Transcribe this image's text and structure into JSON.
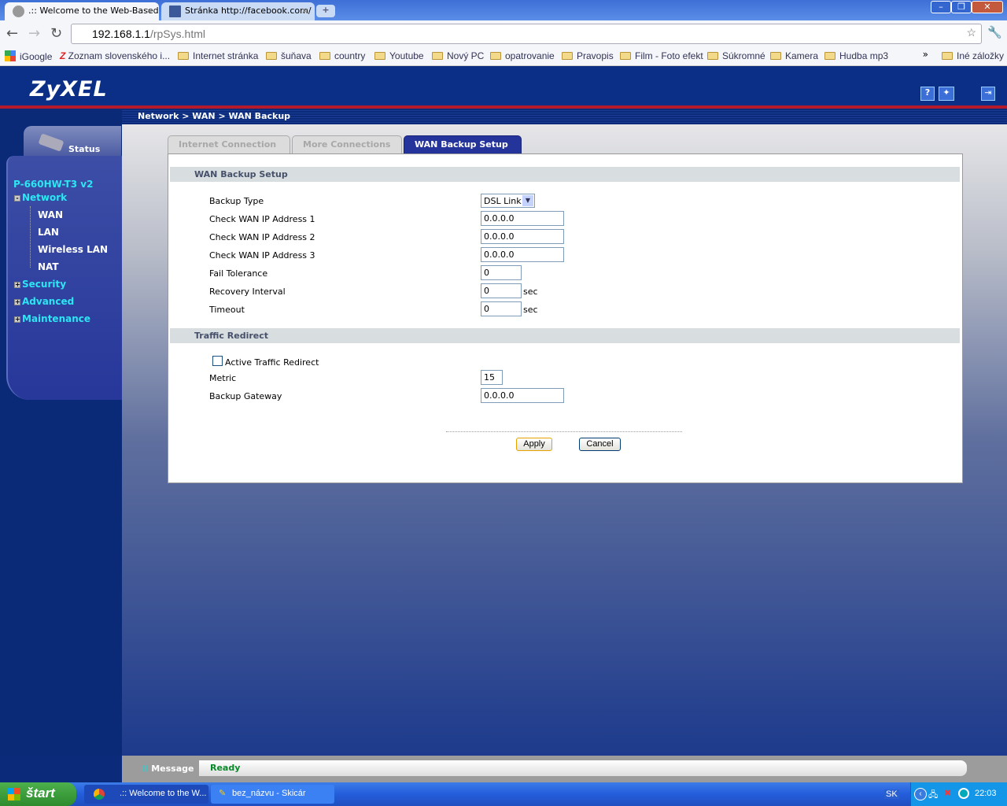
{
  "browser": {
    "tabs": [
      {
        "label": ".:: Welcome to the Web-Based"
      },
      {
        "label": "Stránka http://facebook.com/"
      }
    ],
    "url_host": "192.168.1.1",
    "url_path": "/rpSys.html",
    "bookmarks": [
      "iGoogle",
      "Zoznam slovenského i...",
      "Internet stránka",
      "šuňava",
      "country",
      "Youtube",
      "Nový PC",
      "opatrovanie",
      "Pravopis",
      "Film - Foto efekt",
      "Súkromné",
      "Kamera",
      "Hudba mp3"
    ],
    "other_bookmarks": "Iné záložky"
  },
  "app": {
    "logo": "ZyXEL",
    "breadcrumb": "Network > WAN > WAN Backup",
    "status_tab": "Status",
    "model": "P-660HW-T3 v2",
    "menu": {
      "network": "Network",
      "wan": "WAN",
      "lan": "LAN",
      "wlan": "Wireless LAN",
      "nat": "NAT",
      "security": "Security",
      "advanced": "Advanced",
      "maintenance": "Maintenance"
    },
    "tabs": [
      "Internet Connection",
      "More Connections",
      "WAN Backup Setup"
    ],
    "section1": "WAN Backup Setup",
    "fields": {
      "backup_type": {
        "label": "Backup Type",
        "value": "DSL Link"
      },
      "ip1": {
        "label": "Check WAN IP Address  1",
        "value": "0.0.0.0"
      },
      "ip2": {
        "label": "Check WAN IP Address  2",
        "value": "0.0.0.0"
      },
      "ip3": {
        "label": "Check WAN IP Address  3",
        "value": "0.0.0.0"
      },
      "fail": {
        "label": "Fail Tolerance",
        "value": "0"
      },
      "recovery": {
        "label": "Recovery Interval",
        "value": "0",
        "unit": "sec"
      },
      "timeout": {
        "label": "Timeout",
        "value": "0",
        "unit": "sec"
      }
    },
    "section2": "Traffic Redirect",
    "redirect": {
      "active_label": "Active Traffic Redirect",
      "active_checked": false,
      "metric_label": "Metric",
      "metric": "15",
      "gateway_label": "Backup Gateway",
      "gateway": "0.0.0.0"
    },
    "apply": "Apply",
    "cancel": "Cancel",
    "message_label": "Message",
    "message": "Ready"
  },
  "taskbar": {
    "start": "štart",
    "items": [
      ".:: Welcome to the W...",
      "bez_názvu - Skicár"
    ],
    "lang": "SK",
    "clock": "22:03"
  }
}
